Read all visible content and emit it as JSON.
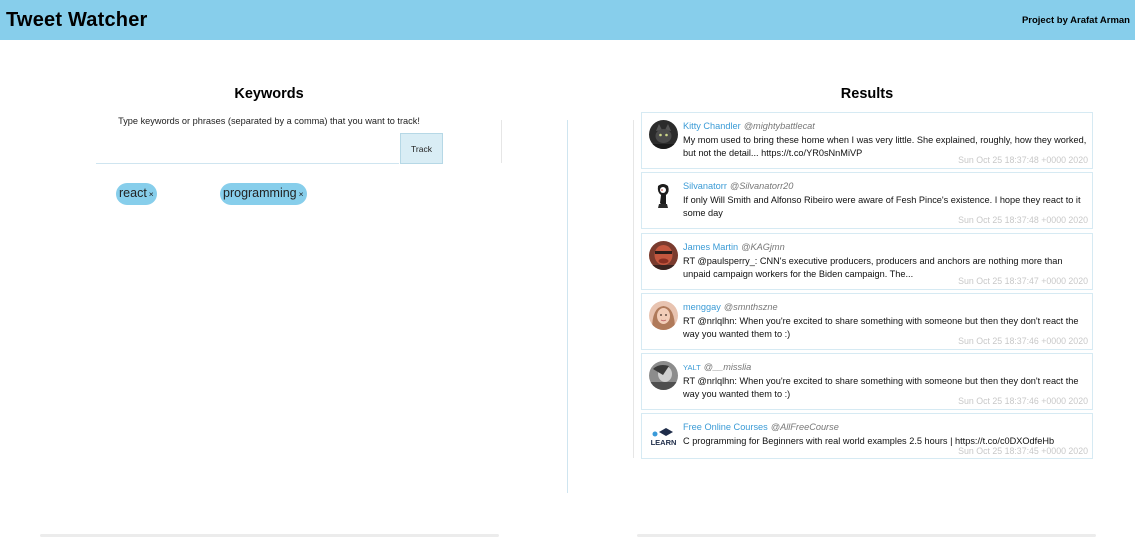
{
  "header": {
    "title": "Tweet Watcher",
    "author": "Project by Arafat Arman"
  },
  "keywords_panel": {
    "title": "Keywords",
    "instructions": "Type keywords or phrases (separated by a comma) that you want to track!",
    "input_value": "",
    "track_label": "Track",
    "chips": [
      {
        "label": "react",
        "remove": "×"
      },
      {
        "label": "programming",
        "remove": "×"
      }
    ]
  },
  "results_panel": {
    "title": "Results",
    "tweets": [
      {
        "name": "Kitty Chandler",
        "handle": "@mightybattlecat",
        "text": "My mom used to bring these home when I was very little. She explained, roughly, how they worked, but not the detail... https://t.co/YR0sNnMiVP",
        "date": "Sun Oct 25 18:37:48 +0000 2020",
        "avatar": "cat-avatar"
      },
      {
        "name": "Silvanatorr",
        "handle": "@Silvanatorr20",
        "text": "If only Will Smith and Alfonso Ribeiro were aware of Fesh Pince's existence. I hope they react to it some day",
        "date": "Sun Oct 25 18:37:48 +0000 2020",
        "avatar": "sketch-avatar"
      },
      {
        "name": "James Martin",
        "handle": "@KAGjmn",
        "text": "RT @paulsperry_: CNN's executive producers, producers and anchors are nothing more than unpaid campaign workers for the Biden campaign. The...",
        "date": "Sun Oct 25 18:37:47 +0000 2020",
        "avatar": "red-face-avatar"
      },
      {
        "name": "menggay",
        "handle": "@smnthszne",
        "text": "RT @nrlqlhn: When you're excited to share something with someone but then they don't react the way you wanted them to :)",
        "date": "Sun Oct 25 18:37:46 +0000 2020",
        "avatar": "woman-avatar"
      },
      {
        "name": "YALT",
        "handle": "@__misslia",
        "text": "RT @nrlqlhn: When you're excited to share something with someone but then they don't react the way you wanted them to :)",
        "date": "Sun Oct 25 18:37:46 +0000 2020",
        "avatar": "grey-photo-avatar"
      },
      {
        "name": "Free Online Courses",
        "handle": "@AllFreeCourse",
        "text": "C programming for Beginners with real world examples 2.5 hours | https://t.co/c0DXOdfeHb",
        "date": "Sun Oct 25 18:37:45 +0000 2020",
        "avatar": "learn-logo-avatar",
        "avatar_text": "LEARN"
      }
    ]
  },
  "colors": {
    "header_bg": "#87ceeb",
    "chip_bg": "#87ceeb",
    "name_link": "#3b9bd6"
  }
}
